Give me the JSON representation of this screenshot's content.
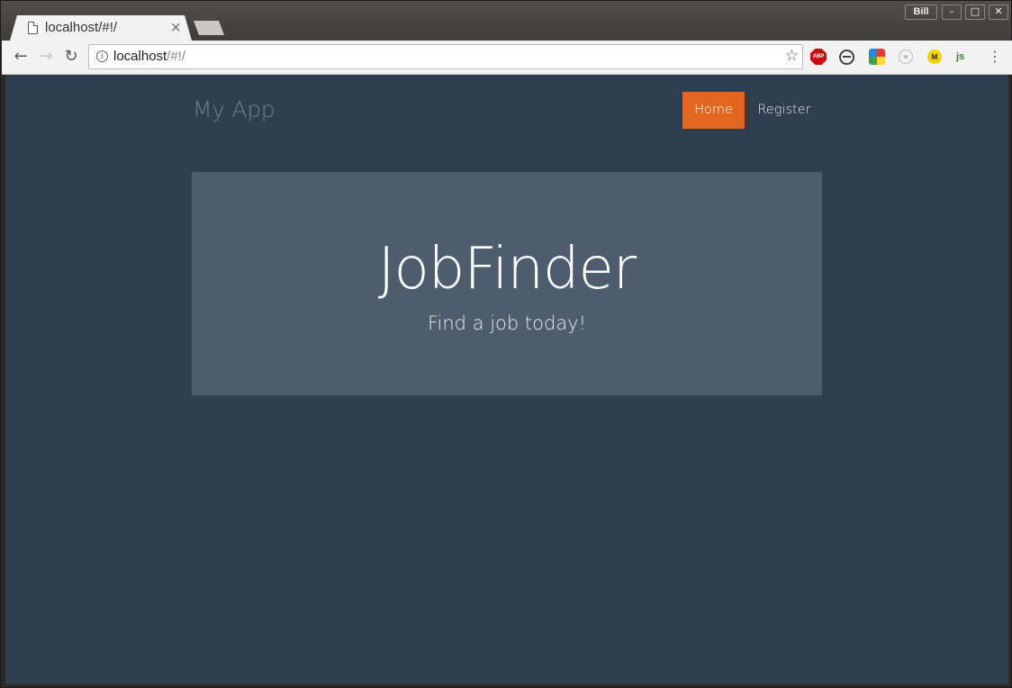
{
  "browser": {
    "tab_title": "localhost/#!/",
    "tab_close": "×",
    "user_name": "Bill",
    "window_controls": {
      "minimize": "–",
      "maximize": "□",
      "close": "✕"
    },
    "nav": {
      "back": "←",
      "forward": "→",
      "reload": "↻"
    },
    "url_host": "localhost",
    "url_path": "/#!/",
    "info_icon": "i",
    "bookmark_star": "☆",
    "extensions": {
      "adblock_label": "ABP",
      "m_label": "M",
      "js_label": "js"
    },
    "menu": "⋮"
  },
  "page": {
    "brand": "My App",
    "nav": {
      "home": "Home",
      "register": "Register"
    },
    "hero": {
      "title": "JobFinder",
      "subtitle": "Find a job today!"
    },
    "colors": {
      "background": "#2f3e50",
      "jumbotron": "#4e5d6d",
      "active_nav": "#e1661e"
    }
  }
}
